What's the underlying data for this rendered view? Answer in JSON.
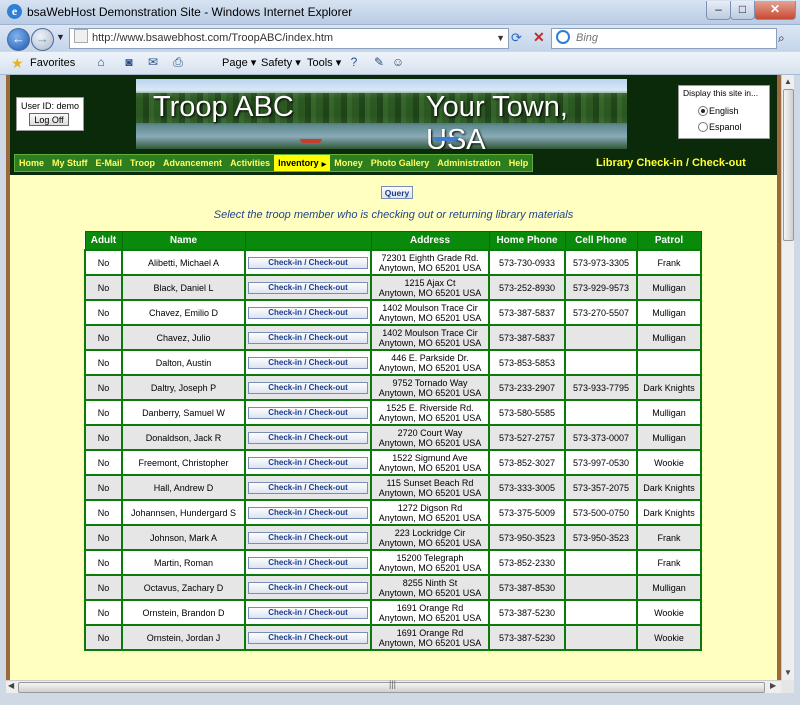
{
  "window": {
    "title": "bsaWebHost Demonstration Site - Windows Internet Explorer",
    "min": "–",
    "max": "□",
    "close": "✕"
  },
  "address": {
    "url": "http://www.bsawebhost.com/TroopABC/index.htm",
    "search_placeholder": "Bing"
  },
  "favorites": {
    "label": "Favorites",
    "page": "Page",
    "safety": "Safety",
    "tools": "Tools"
  },
  "site": {
    "user_id": "User ID: demo",
    "logoff": "Log Off",
    "banner_left": "Troop ABC",
    "banner_right": "Your Town, USA",
    "lang_title": "Display this site in...",
    "lang_options": [
      "English",
      "Espanol"
    ],
    "menu": [
      "Home",
      "My Stuff",
      "E-Mail",
      "Troop",
      "Advancement",
      "Activities",
      "Inventory",
      "Money",
      "Photo Gallery",
      "Administration",
      "Help"
    ],
    "page_title": "Library Check-in / Check-out",
    "query": "Query",
    "instruction": "Select the troop member who is checking out or returning library materials",
    "button_label": "Check-in / Check-out"
  },
  "table": {
    "headers": [
      "Adult",
      "Name",
      "",
      "Address",
      "Home Phone",
      "Cell Phone",
      "Patrol"
    ],
    "rows": [
      {
        "adult": "No",
        "name": "Alibetti, Michael A",
        "addr1": "72301 Eighth Grade Rd.",
        "addr2": "Anytown, MO 65201 USA",
        "home": "573-730-0933",
        "cell": "573-973-3305",
        "patrol": "Frank"
      },
      {
        "adult": "No",
        "name": "Black, Daniel L",
        "addr1": "1215 Ajax Ct",
        "addr2": "Anytown, MO 65201 USA",
        "home": "573-252-8930",
        "cell": "573-929-9573",
        "patrol": "Mulligan"
      },
      {
        "adult": "No",
        "name": "Chavez, Emilio D",
        "addr1": "1402 Moulson Trace Cir",
        "addr2": "Anytown, MO 65201 USA",
        "home": "573-387-5837",
        "cell": "573-270-5507",
        "patrol": "Mulligan"
      },
      {
        "adult": "No",
        "name": "Chavez, Julio",
        "addr1": "1402 Moulson Trace Cir",
        "addr2": "Anytown, MO 65201 USA",
        "home": "573-387-5837",
        "cell": "",
        "patrol": "Mulligan"
      },
      {
        "adult": "No",
        "name": "Dalton, Austin",
        "addr1": "446 E. Parkside Dr.",
        "addr2": "Anytown, MO 65201 USA",
        "home": "573-853-5853",
        "cell": "",
        "patrol": ""
      },
      {
        "adult": "No",
        "name": "Daltry, Joseph P",
        "addr1": "9752 Tornado Way",
        "addr2": "Anytown, MO 65201 USA",
        "home": "573-233-2907",
        "cell": "573-933-7795",
        "patrol": "Dark Knights"
      },
      {
        "adult": "No",
        "name": "Danberry, Samuel W",
        "addr1": "1525 E. Riverside Rd.",
        "addr2": "Anytown, MO 65201 USA",
        "home": "573-580-5585",
        "cell": "",
        "patrol": "Mulligan"
      },
      {
        "adult": "No",
        "name": "Donaldson, Jack R",
        "addr1": "2720 Court Way",
        "addr2": "Anytown, MO 65201 USA",
        "home": "573-527-2757",
        "cell": "573-373-0007",
        "patrol": "Mulligan"
      },
      {
        "adult": "No",
        "name": "Freemont, Christopher",
        "addr1": "1522 Sigmund Ave",
        "addr2": "Anytown, MO 65201 USA",
        "home": "573-852-3027",
        "cell": "573-997-0530",
        "patrol": "Wookie"
      },
      {
        "adult": "No",
        "name": "Hall, Andrew D",
        "addr1": "115 Sunset Beach Rd",
        "addr2": "Anytown, MO 65201 USA",
        "home": "573-333-3005",
        "cell": "573-357-2075",
        "patrol": "Dark Knights"
      },
      {
        "adult": "No",
        "name": "Johannsen, Hundergard S",
        "addr1": "1272 Digson Rd",
        "addr2": "Anytown, MO 65201 USA",
        "home": "573-375-5009",
        "cell": "573-500-0750",
        "patrol": "Dark Knights"
      },
      {
        "adult": "No",
        "name": "Johnson, Mark A",
        "addr1": "223 Lockridge Cir",
        "addr2": "Anytown, MO 65201 USA",
        "home": "573-950-3523",
        "cell": "573-950-3523",
        "patrol": "Frank"
      },
      {
        "adult": "No",
        "name": "Martin, Roman",
        "addr1": "15200 Telegraph",
        "addr2": "Anytown, MO 65201 USA",
        "home": "573-852-2330",
        "cell": "",
        "patrol": "Frank"
      },
      {
        "adult": "No",
        "name": "Octavus, Zachary D",
        "addr1": "8255 Ninth St",
        "addr2": "Anytown, MO 65201 USA",
        "home": "573-387-8530",
        "cell": "",
        "patrol": "Mulligan"
      },
      {
        "adult": "No",
        "name": "Ornstein, Brandon D",
        "addr1": "1691 Orange Rd",
        "addr2": "Anytown, MO 65201 USA",
        "home": "573-387-5230",
        "cell": "",
        "patrol": "Wookie"
      },
      {
        "adult": "No",
        "name": "Ornstein, Jordan J",
        "addr1": "1691 Orange Rd",
        "addr2": "Anytown, MO 65201 USA",
        "home": "573-387-5230",
        "cell": "",
        "patrol": "Wookie"
      }
    ]
  }
}
